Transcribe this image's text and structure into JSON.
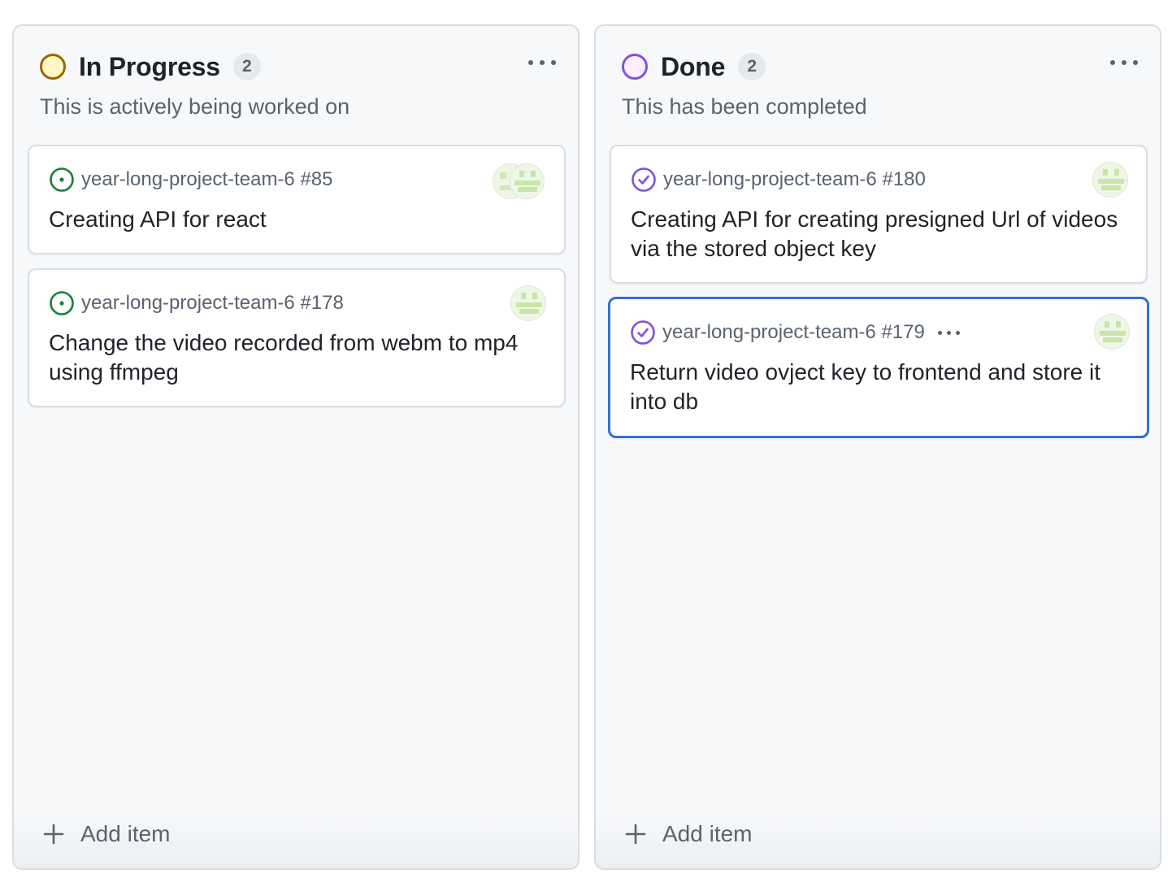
{
  "colors": {
    "in_progress_ring": "#9a6700",
    "in_progress_fill": "#fff8c5",
    "done_ring": "#8250df",
    "open_issue": "#1a7f37",
    "closed_issue": "#8250df",
    "selected_border": "#2f72d1"
  },
  "columns": [
    {
      "title": "In Progress",
      "count": "2",
      "description": "This is actively being worked on",
      "add_label": "Add item",
      "cards": [
        {
          "ref": "year-long-project-team-6 #85",
          "title": "Creating API for react",
          "state": "open",
          "icon": "issue-opened-icon"
        },
        {
          "ref": "year-long-project-team-6 #178",
          "title": "Change the video recorded from webm to mp4 using ffmpeg",
          "state": "open",
          "icon": "issue-opened-icon"
        }
      ]
    },
    {
      "title": "Done",
      "count": "2",
      "description": "This has been completed",
      "add_label": "Add item",
      "cards": [
        {
          "ref": "year-long-project-team-6 #180",
          "title": "Creating API for creating presigned Url of videos via the stored object key",
          "state": "closed",
          "icon": "issue-closed-icon"
        },
        {
          "ref": "year-long-project-team-6 #179",
          "title": "Return video ovject key to frontend and store it into db",
          "state": "closed",
          "icon": "issue-closed-icon",
          "selected": true
        }
      ]
    }
  ]
}
